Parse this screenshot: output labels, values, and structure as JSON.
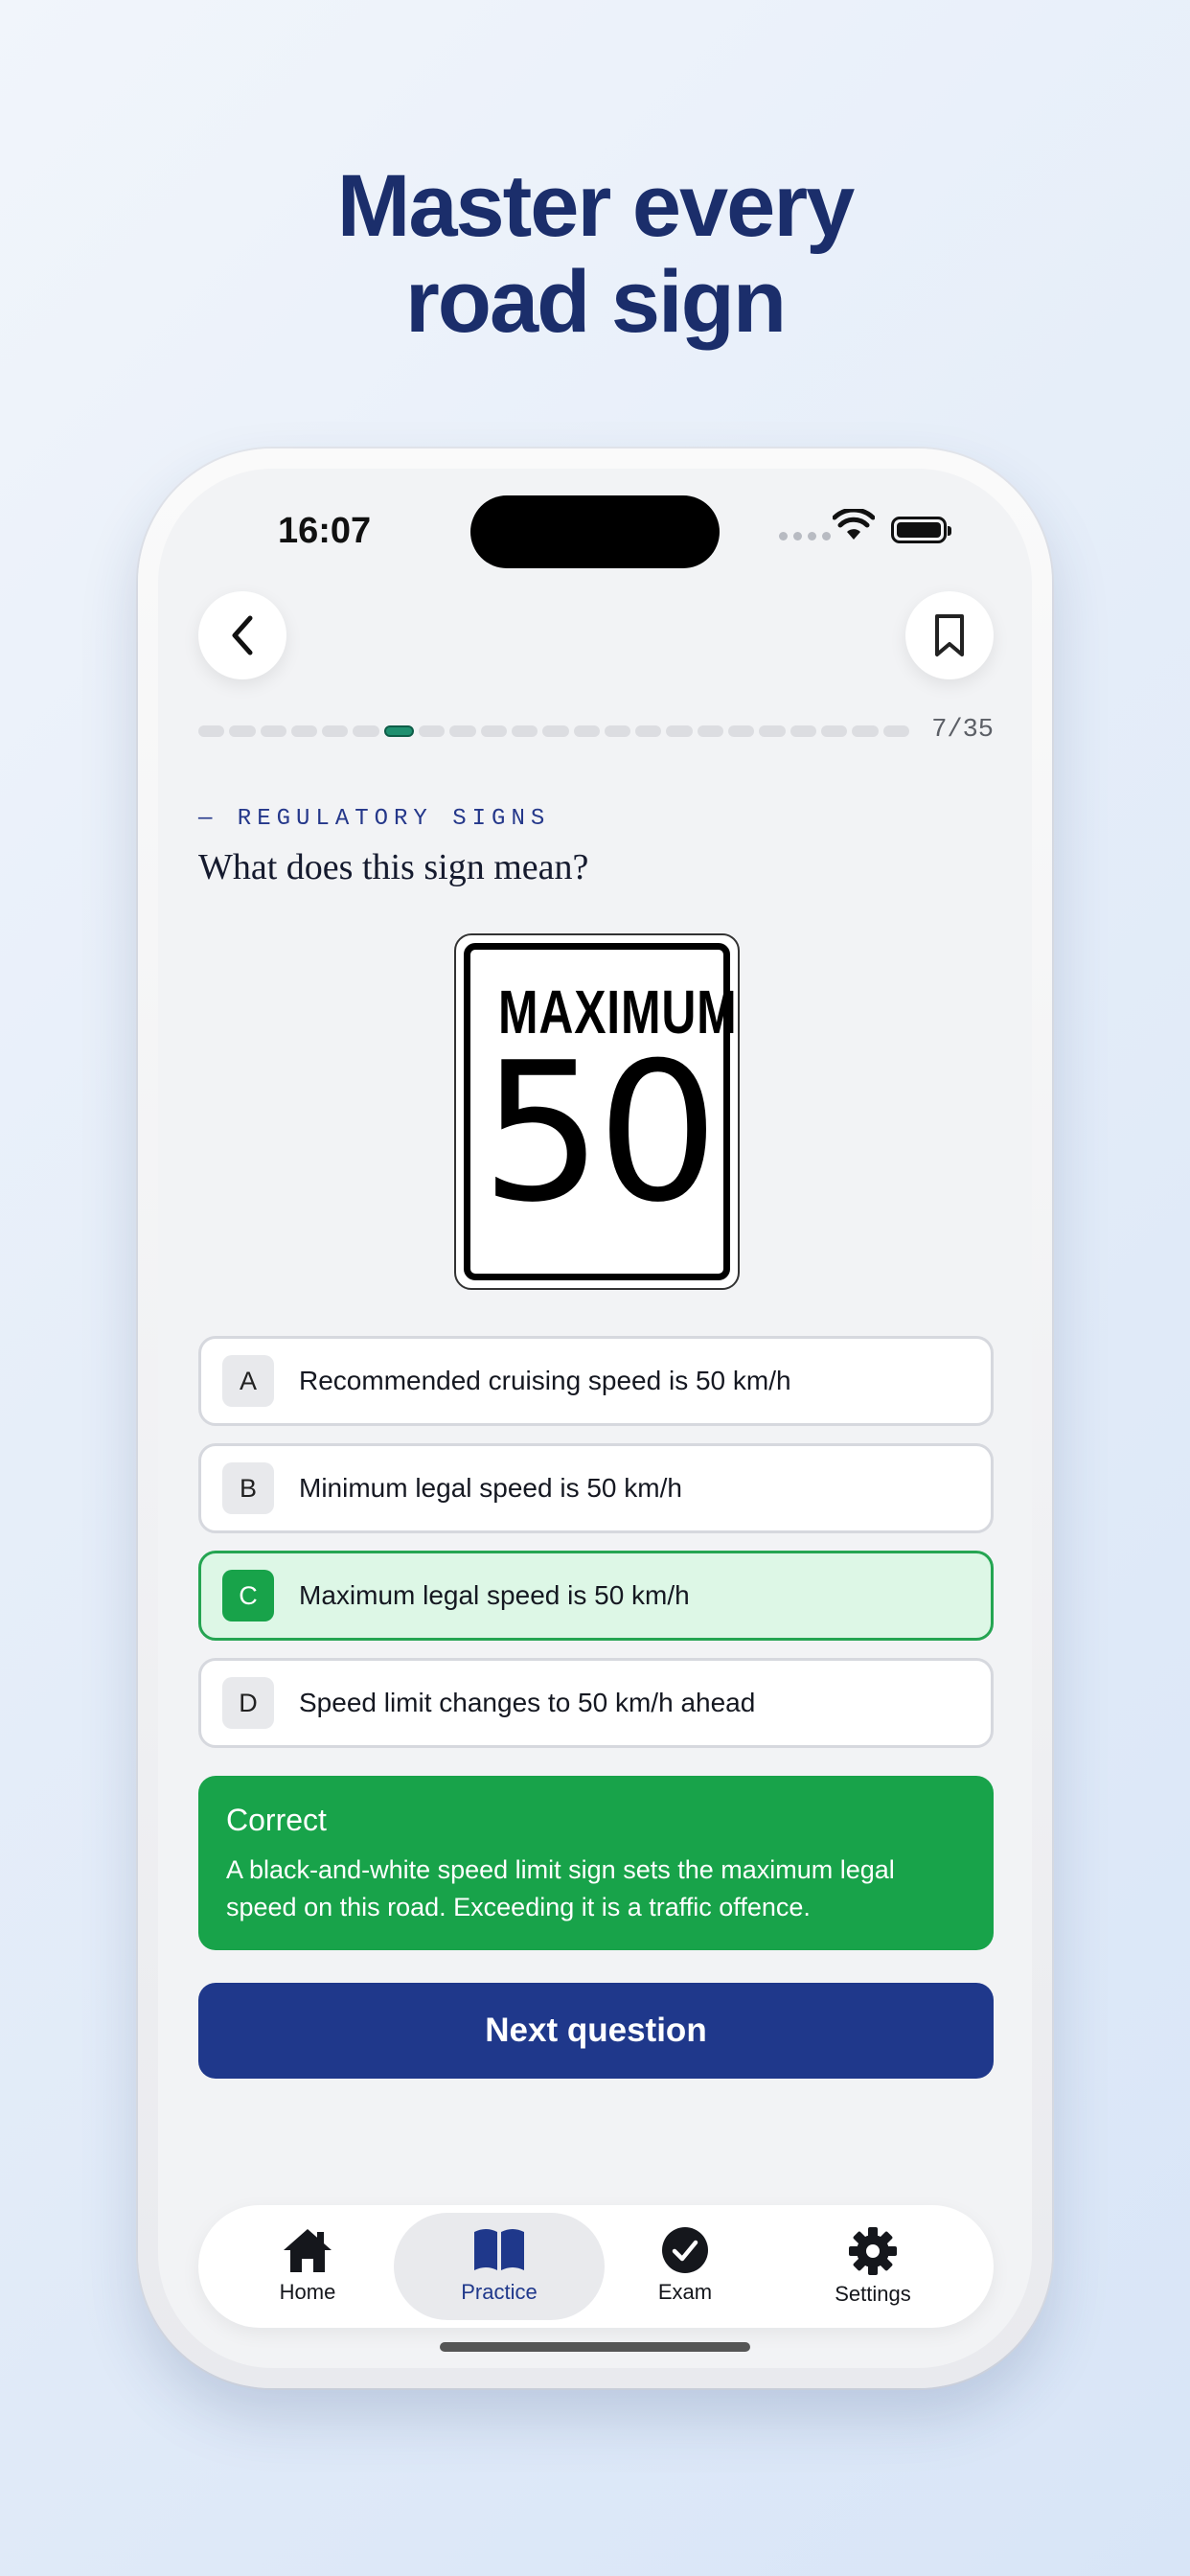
{
  "headline": {
    "line1": "Master every",
    "line2": "road sign"
  },
  "status_bar": {
    "time": "16:07"
  },
  "progress": {
    "current": 7,
    "total": 35,
    "label": "7/35"
  },
  "category": "— REGULATORY SIGNS",
  "question": "What does this sign mean?",
  "sign": {
    "top_text": "MAXIMUM",
    "number": "50"
  },
  "options": [
    {
      "letter": "A",
      "text": "Recommended cruising speed is 50 km/h"
    },
    {
      "letter": "B",
      "text": "Minimum legal speed is 50 km/h"
    },
    {
      "letter": "C",
      "text": "Maximum legal speed is 50 km/h",
      "correct": true
    },
    {
      "letter": "D",
      "text": "Speed limit changes to 50 km/h ahead"
    }
  ],
  "feedback": {
    "title": "Correct",
    "body": "A black-and-white speed limit sign sets the maximum legal speed on this road. Exceeding it is a traffic offence."
  },
  "next_button": "Next question",
  "tabs": [
    {
      "label": "Home",
      "icon": "home-icon"
    },
    {
      "label": "Practice",
      "icon": "book-icon",
      "active": true
    },
    {
      "label": "Exam",
      "icon": "check-circle-icon"
    },
    {
      "label": "Settings",
      "icon": "gear-icon"
    }
  ],
  "colors": {
    "brand_navy": "#1f388b",
    "success_green": "#18a34a",
    "correct_bg": "#ddf7e6",
    "headline": "#1b2e6b"
  }
}
